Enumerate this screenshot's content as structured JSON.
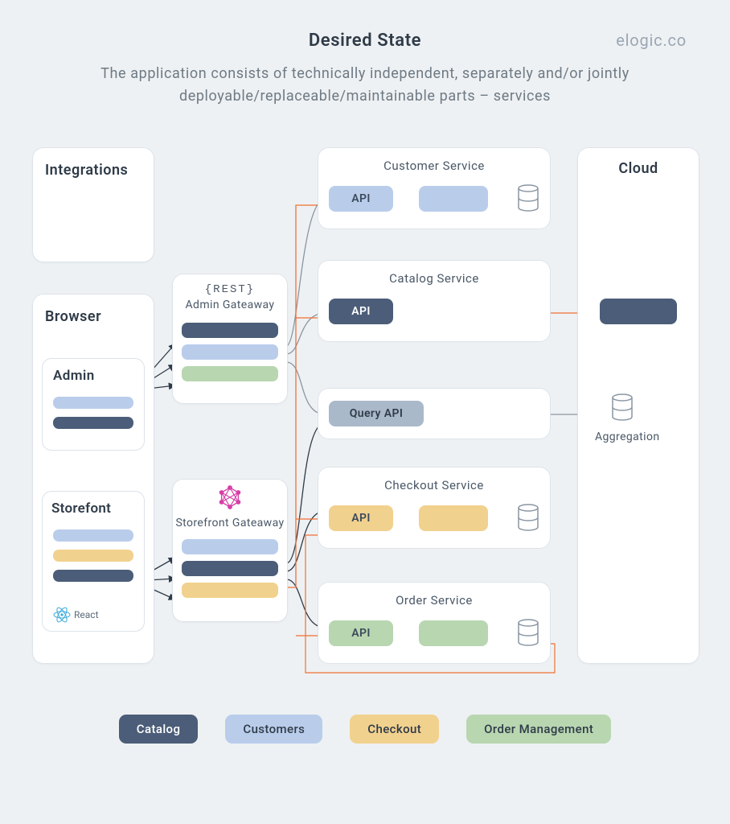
{
  "header": {
    "title": "Desired State",
    "brand": "elogic.co",
    "subtitle": "The application consists of technically independent, separately and/or jointly deployable/replaceable/maintainable parts – services"
  },
  "integrations": {
    "label": "Integrations"
  },
  "browser": {
    "label": "Browser",
    "admin": {
      "label": "Admin"
    },
    "storefront": {
      "label": "Storefont",
      "tech": "React"
    }
  },
  "gateways": {
    "admin": {
      "rest": "{REST}",
      "label": "Admin Gateaway"
    },
    "storefront": {
      "label": "Storefront Gateaway"
    }
  },
  "services": {
    "customer": {
      "label": "Customer Service",
      "api": "API"
    },
    "catalog": {
      "label": "Catalog Service",
      "api": "API"
    },
    "query": {
      "api": "Query API"
    },
    "checkout": {
      "label": "Checkout Service",
      "api": "API"
    },
    "order": {
      "label": "Order Service",
      "api": "API"
    }
  },
  "cloud": {
    "label": "Cloud",
    "aggregation": "Aggregation"
  },
  "legend": {
    "catalog": "Catalog",
    "customers": "Customers",
    "checkout": "Checkout",
    "order": "Order Management"
  },
  "colors": {
    "catalog": "#4b5d78",
    "customers": "#b9cdeb",
    "checkout": "#f1d18e",
    "order": "#b8d6b0",
    "accent": "#f07135"
  }
}
